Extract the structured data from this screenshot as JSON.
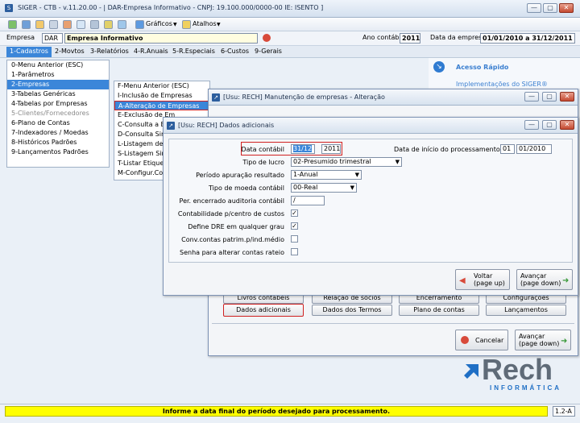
{
  "titlebar": {
    "text": "SIGER - CTB - v.11.20.00 - | DAR-Empresa Informativo - CNPJ: 19.100.000/0000-00 IE: ISENTO ]"
  },
  "toolbar": {
    "graficos": "Gráficos",
    "atalhos": "Atalhos"
  },
  "infobar": {
    "empresa_label": "Empresa",
    "empresa_code": "DAR",
    "empresa_name": "Empresa Informativo",
    "ano_label": "Ano contábil",
    "ano_value": "2011",
    "data_label": "Data da empresa",
    "data_value": "01/01/2010 a 31/12/2011"
  },
  "menubar": [
    "1-Cadastros",
    "2-Movtos",
    "3-Relatórios",
    "4-R.Anuais",
    "5-R.Especiais",
    "6-Custos",
    "9-Gerais"
  ],
  "main_menu": [
    "0-Menu Anterior (ESC)",
    "1-Parâmetros",
    "2-Empresas",
    "3-Tabelas Genéricas",
    "4-Tabelas por Empresas",
    "5-Clientes/Fornecedores",
    "6-Plano de Contas",
    "7-Indexadores / Moedas",
    "8-Históricos Padrões",
    "9-Lançamentos Padrões"
  ],
  "sub_menu": [
    "F-Menu Anterior (ESC)",
    "I-Inclusão de Empresas",
    "A-Alteração de Empresas",
    "E-Exclusão de Em",
    "C-Consulta a Em",
    "D-Consulta Simp",
    "L-Listagem de Em",
    "S-Listagem Simp",
    "T-Listar Etiqueta",
    "M-Configur.Com"
  ],
  "side": {
    "acesso": "Acesso Rápido",
    "link": "Implementações do SIGER®"
  },
  "win_manut": {
    "title": "[Usu: RECH] Manutenção de empresas - Alteração",
    "row1": [
      "Livros contábeis",
      "Relação de sócios",
      "Encerramento",
      "Configurações"
    ],
    "row2": [
      "Dados adicionais",
      "Dados dos Termos",
      "Plano de contas",
      "Lançamentos"
    ],
    "cancel": "Cancelar",
    "advance1": "Avançar",
    "advance2": "(page down)"
  },
  "win_dados": {
    "title": "[Usu: RECH] Dados adicionais",
    "data_contabil_label": "Data contábil",
    "data_contabil_mes": "31/12",
    "data_contabil_ano": "2011",
    "inicio_label": "Data de início do processamento",
    "inicio_dia": "01",
    "inicio_data": "01/2010",
    "tipo_lucro_label": "Tipo de lucro",
    "tipo_lucro_value": "02-Presumido trimestral",
    "periodo_label": "Período apuração resultado",
    "periodo_value": "1-Anual",
    "moeda_label": "Tipo de moeda contábil",
    "moeda_value": "00-Real",
    "auditoria_label": "Per. encerrado auditoria contábil",
    "auditoria_value": "/",
    "contab_label": "Contabilidade p/centro de custos",
    "dre_label": "Define DRE em qualquer grau",
    "conv_label": "Conv.contas patrim.p/ind.médio",
    "senha_label": "Senha para alterar contas rateio",
    "voltar1": "Voltar",
    "voltar2": "(page up)",
    "avancar1": "Avançar",
    "avancar2": "(page down)"
  },
  "logo": {
    "name": "Rech",
    "sub": "INFORMÁTICA"
  },
  "status": {
    "message": "Informe a data final do período desejado para processamento.",
    "code": "1.2-A"
  },
  "colors": {
    "accent": "#3b86d9",
    "highlight": "#d02020",
    "status_bg": "#ffff00",
    "logo_blue": "#1f6fc5",
    "logo_gray": "#5f6b78"
  }
}
